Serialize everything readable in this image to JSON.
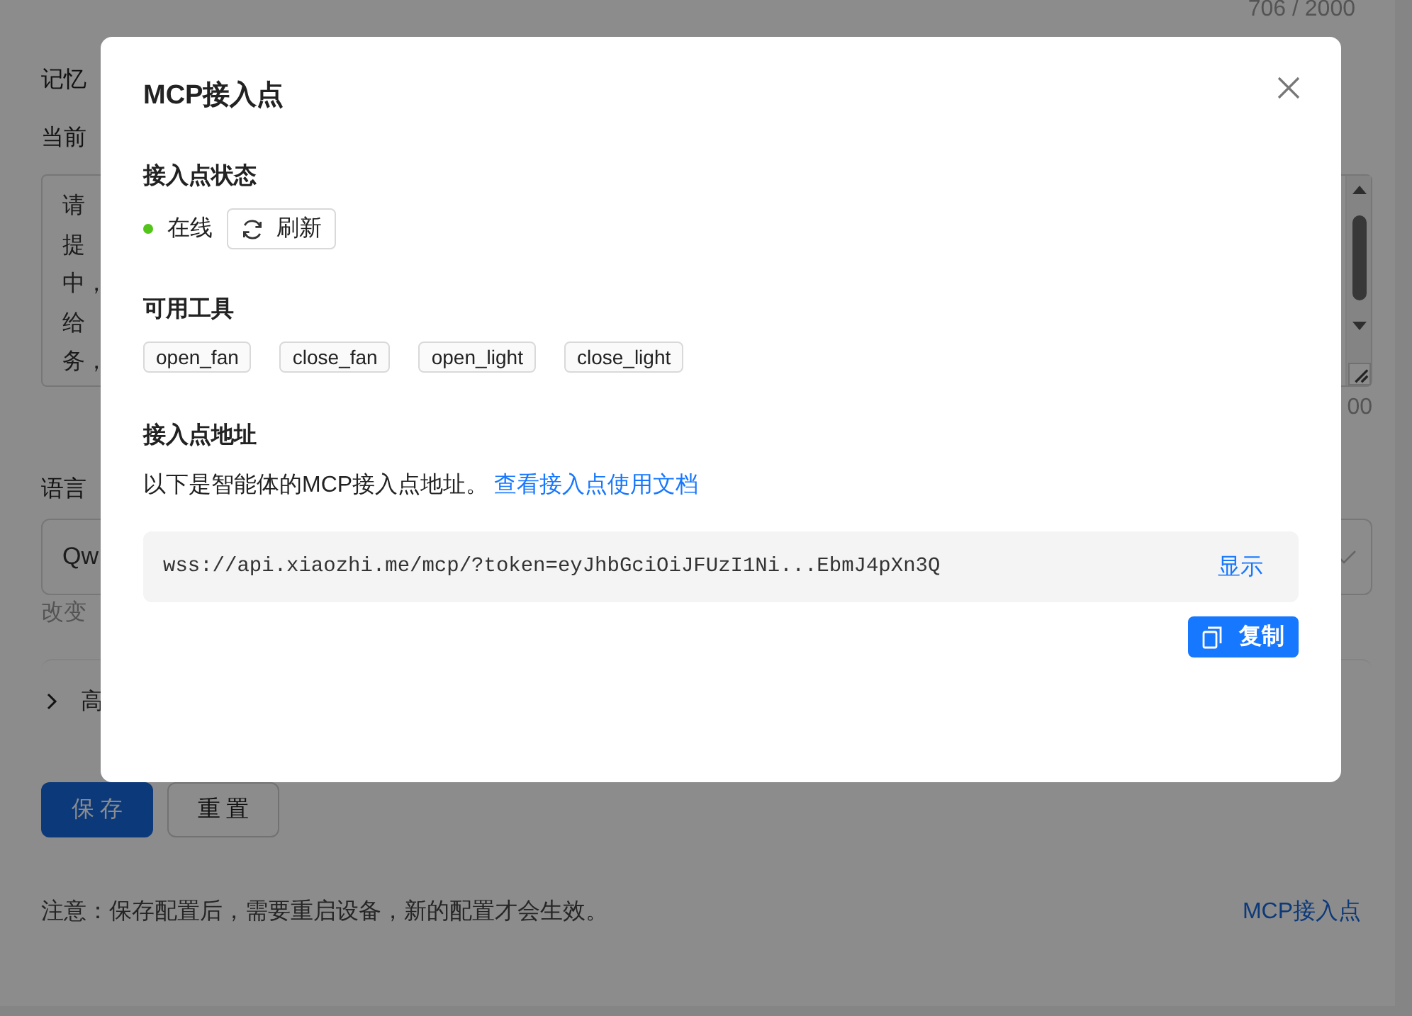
{
  "page": {
    "counter_top": "706 / 2000",
    "memory_label": "记忆",
    "prompt_label": "当前",
    "prompt_lines": [
      "请",
      "提",
      "中，",
      "给",
      "务，"
    ],
    "counter": "00",
    "language_label": "语言",
    "model_value": "Qw",
    "model_hint": "改变",
    "advanced_label": "高",
    "buttons": [
      {
        "label": "保 存",
        "kind": "primary"
      },
      {
        "label": "重 置",
        "kind": "default"
      }
    ],
    "note": "注意：保存配置后，需要重启设备，新的配置才会生效。",
    "mcp_link": "MCP接入点"
  },
  "dialog": {
    "title": "MCP接入点",
    "status_heading": "接入点状态",
    "status": {
      "text": "在线",
      "color": "#52c41a"
    },
    "refresh_button": "刷新",
    "tools_heading": "可用工具",
    "tools": [
      "open_fan",
      "close_fan",
      "open_light",
      "close_light"
    ],
    "address_heading": "接入点地址",
    "address_intro": "以下是智能体的MCP接入点地址。",
    "docs_link": "查看接入点使用文档",
    "address": "wss://api.xiaozhi.me/mcp/?token=eyJhbGciOiJFUzI1Ni...EbmJ4pXn3Q",
    "show_button": "显示",
    "copy_button": "复制"
  }
}
